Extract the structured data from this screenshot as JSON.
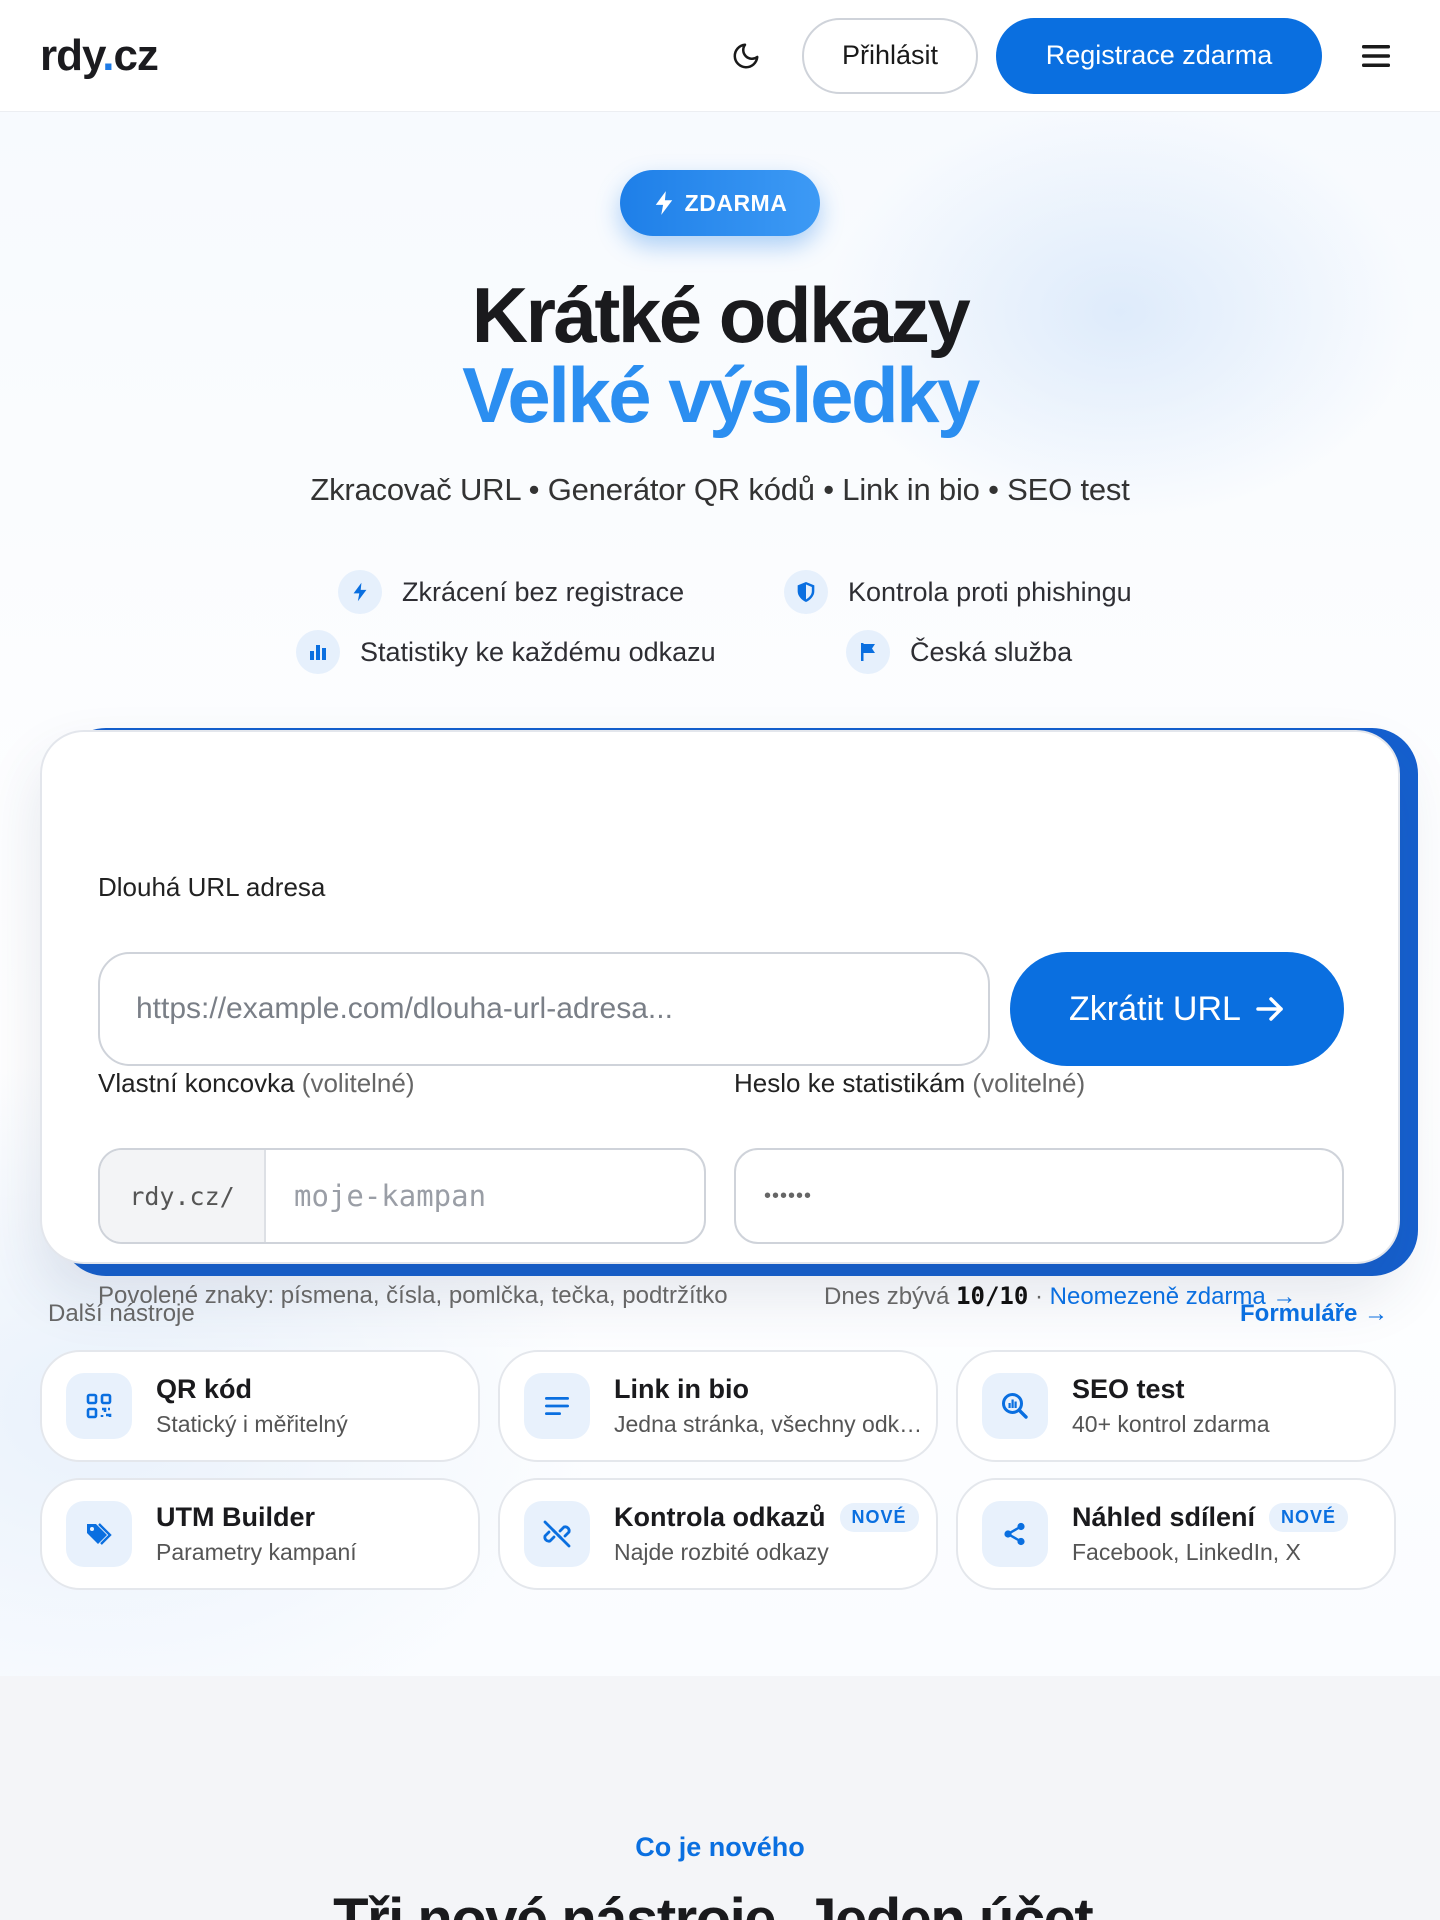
{
  "header": {
    "logo_main": "rdy",
    "logo_dot": ".",
    "logo_tld": "cz",
    "login_label": "Přihlásit",
    "register_label": "Registrace zdarma"
  },
  "hero": {
    "badge": "ZDARMA",
    "title_line1": "Krátké odkazy",
    "title_line2": "Velké výsledky",
    "subtitle": "Zkracovač URL • Generátor QR kódů • Link in bio • SEO test",
    "features": [
      {
        "label": "Zkrácení bez registrace",
        "icon": "bolt-icon"
      },
      {
        "label": "Kontrola proti phishingu",
        "icon": "shield-icon"
      },
      {
        "label": "Statistiky ke každému odkazu",
        "icon": "bar-chart-icon"
      },
      {
        "label": "Česká služba",
        "icon": "flag-icon"
      }
    ]
  },
  "form": {
    "url_label": "Dlouhá URL adresa",
    "url_placeholder": "https://example.com/dlouha-url-adresa...",
    "shorten_label": "Zkrátit URL",
    "slug_label": "Vlastní koncovka",
    "slug_optional": "(volitelné)",
    "slug_prefix": "rdy.cz/",
    "slug_placeholder": "moje-kampan",
    "password_label": "Heslo ke statistikám",
    "password_optional": "(volitelné)",
    "password_value": "••••••",
    "allowed_chars": "Povolené znaky: písmena, čísla, pomlčka, tečka, podtržítko",
    "remaining_prefix": "Dnes zbývá",
    "remaining_value": "10/10",
    "remaining_sep": "·",
    "unlimited_link": "Neomezeně zdarma →"
  },
  "tools": {
    "title": "Další nástroje",
    "link": "Formuláře →",
    "items": [
      {
        "name": "QR kód",
        "desc": "Statický i měřitelný",
        "icon": "qr-code-icon",
        "new": ""
      },
      {
        "name": "Link in bio",
        "desc": "Jedna stránka, všechny odkazy",
        "icon": "list-icon",
        "new": ""
      },
      {
        "name": "SEO test",
        "desc": "40+ kontrol zdarma",
        "icon": "search-analytics-icon",
        "new": ""
      },
      {
        "name": "UTM Builder",
        "desc": "Parametry kampaní",
        "icon": "tag-icon",
        "new": ""
      },
      {
        "name": "Kontrola odkazů",
        "desc": "Najde rozbité odkazy",
        "icon": "broken-link-icon",
        "new": "NOVÉ"
      },
      {
        "name": "Náhled sdílení",
        "desc": "Facebook, LinkedIn, X",
        "icon": "share-icon",
        "new": "NOVÉ"
      }
    ]
  },
  "whats_new": {
    "label": "Co je nového",
    "title": "Tři nové nástroje. Jeden účet."
  },
  "colors": {
    "accent": "#0a6fe0",
    "accent_light": "#2b8ef0",
    "icon_bg": "#e8f1fc"
  }
}
